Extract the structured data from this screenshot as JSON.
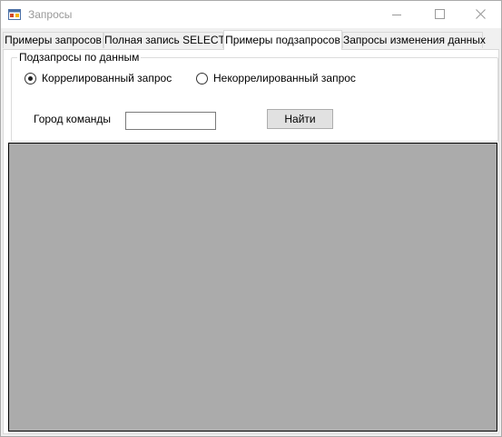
{
  "window": {
    "title": "Запросы",
    "icons": {
      "app": "form-app-icon",
      "minimize": "minimize-icon",
      "maximize": "maximize-icon",
      "close": "close-icon"
    }
  },
  "tabs": [
    {
      "label": "Примеры запросов"
    },
    {
      "label": "Полная запись SELECT"
    },
    {
      "label": "Примеры подзапросов"
    },
    {
      "label": "Запросы изменения данных"
    }
  ],
  "active_tab_index": 2,
  "group": {
    "caption": "Подзапросы по данным",
    "radio_correlated": {
      "label": "Коррелированный запрос",
      "checked": true
    },
    "radio_uncorrelated": {
      "label": "Некоррелированный запрос",
      "checked": false
    },
    "city_label": "Город команды",
    "city_value": "",
    "find_button": "Найти"
  },
  "colors": {
    "grid_background": "#ababab",
    "window_background": "#f0f0f0"
  }
}
